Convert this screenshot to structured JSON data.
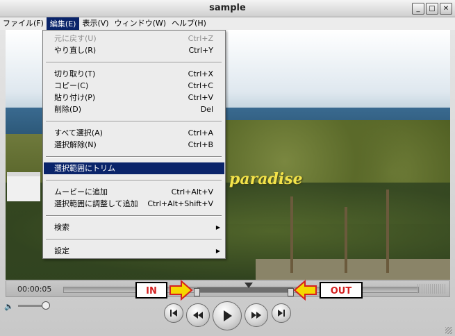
{
  "window": {
    "title": "sample"
  },
  "titlebar_buttons": {
    "minimize": "_",
    "maximize": "□",
    "close": "✕"
  },
  "menubar": {
    "items": [
      {
        "label": "ファイル(F)"
      },
      {
        "label": "編集(E)"
      },
      {
        "label": "表示(V)"
      },
      {
        "label": "ウィンドウ(W)"
      },
      {
        "label": "ヘルプ(H)"
      }
    ]
  },
  "edit_menu": {
    "items": [
      {
        "label": "元に戻す(U)",
        "shortcut": "Ctrl+Z",
        "disabled": true
      },
      {
        "label": "やり直し(R)",
        "shortcut": "Ctrl+Y"
      },
      {
        "label": "切り取り(T)",
        "shortcut": "Ctrl+X"
      },
      {
        "label": "コピー(C)",
        "shortcut": "Ctrl+C"
      },
      {
        "label": "貼り付け(P)",
        "shortcut": "Ctrl+V"
      },
      {
        "label": "削除(D)",
        "shortcut": "Del"
      },
      {
        "label": "すべて選択(A)",
        "shortcut": "Ctrl+A"
      },
      {
        "label": "選択解除(N)",
        "shortcut": "Ctrl+B"
      },
      {
        "label": "選択範囲にトリム",
        "shortcut": "",
        "selected": true
      },
      {
        "label": "ムービーに追加",
        "shortcut": "Ctrl+Alt+V"
      },
      {
        "label": "選択範囲に調整して追加",
        "shortcut": "Ctrl+Alt+Shift+V"
      },
      {
        "label": "検索",
        "shortcut": "",
        "submenu": true
      },
      {
        "label": "設定",
        "shortcut": "",
        "submenu": true
      }
    ]
  },
  "video": {
    "caption": "paradise"
  },
  "timeline": {
    "timecode": "00:00:05"
  },
  "annotations": {
    "in_label": "IN",
    "out_label": "OUT",
    "arrow_color": "#f5d800",
    "arrow_outline": "#d42020"
  },
  "controls": {
    "volume_icon": "speaker-icon",
    "to_start": "skip-to-start-icon",
    "rewind": "rewind-icon",
    "play": "play-icon",
    "fast_forward": "fast-forward-icon",
    "to_end": "skip-to-end-icon"
  }
}
